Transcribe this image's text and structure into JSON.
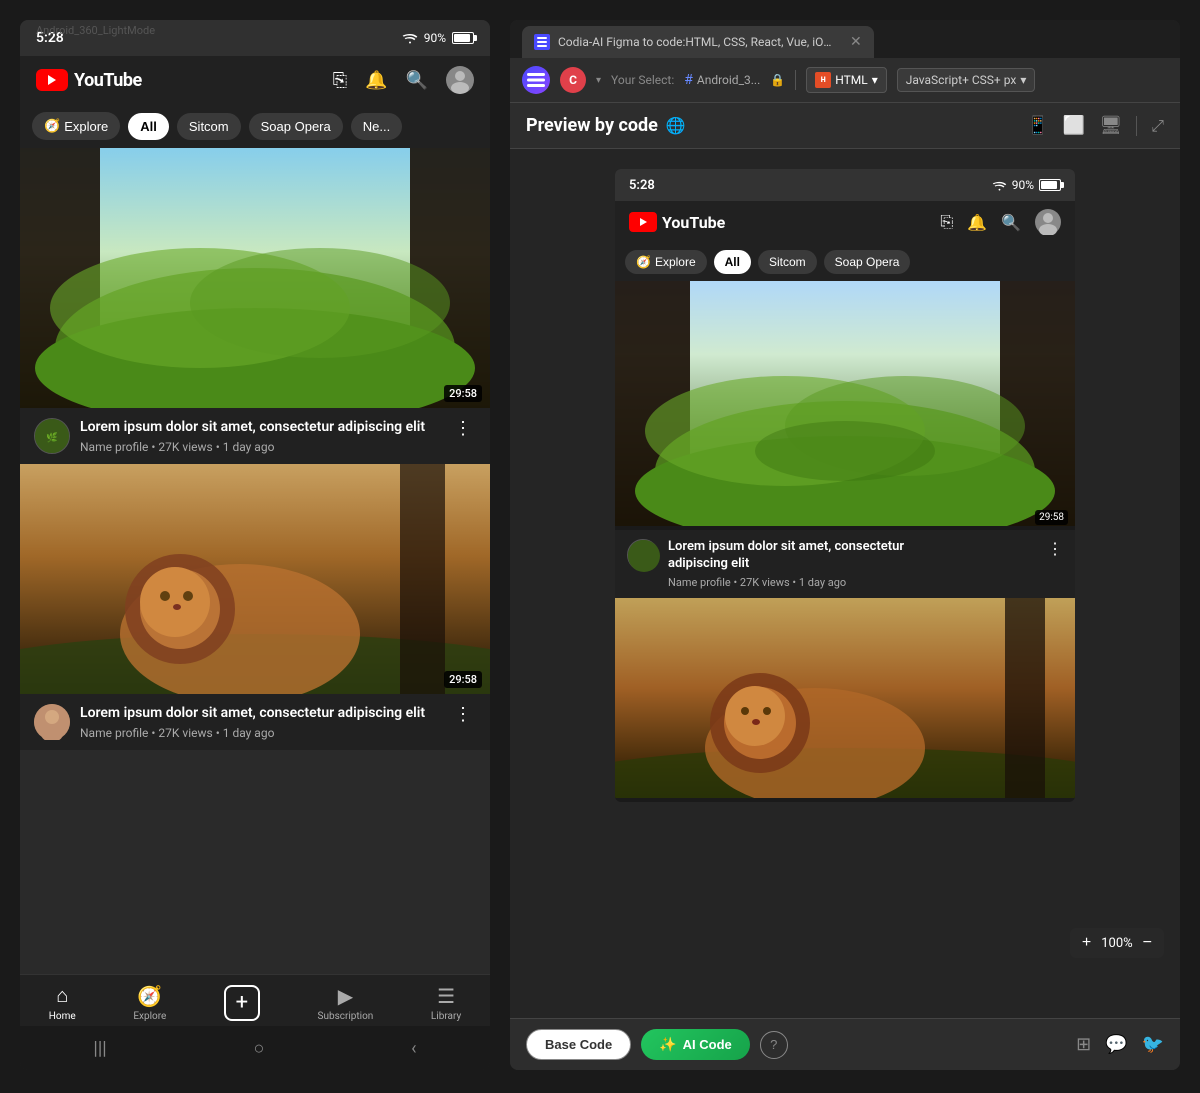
{
  "page": {
    "background": "#1a1a1a"
  },
  "header_label": "Android_360_LightMode",
  "left_panel": {
    "status_bar": {
      "time": "5:28",
      "battery_percent": "90%"
    },
    "yt_header": {
      "logo_text": "YouTube"
    },
    "filter_bar": {
      "items": [
        {
          "label": "Explore",
          "type": "explore"
        },
        {
          "label": "All",
          "type": "active"
        },
        {
          "label": "Sitcom",
          "type": "normal"
        },
        {
          "label": "Soap Opera",
          "type": "normal"
        },
        {
          "label": "Ne...",
          "type": "normal"
        }
      ]
    },
    "video1": {
      "duration": "29:58",
      "title": "Lorem ipsum dolor sit amet, consectetur adipiscing elit",
      "meta": "Name profile • 27K views • 1 day ago"
    },
    "video2": {
      "duration": "29:58",
      "title": "Lorem ipsum dolor sit amet, consectetur adipiscing elit",
      "meta": "Name profile • 27K views • 1 day ago"
    },
    "bottom_nav": {
      "items": [
        {
          "label": "Home",
          "icon": "home"
        },
        {
          "label": "Explore",
          "icon": "explore"
        },
        {
          "label": "",
          "icon": "add"
        },
        {
          "label": "Subscription",
          "icon": "subscription"
        },
        {
          "label": "Library",
          "icon": "library"
        }
      ]
    }
  },
  "right_panel": {
    "tab": {
      "title": "Codia-AI Figma to code:HTML, CSS, React, Vue, iOS, Android, Flutter, Tail..."
    },
    "toolbar": {
      "user_initial": "C",
      "your_select_label": "Your Select:",
      "component_id": "Android_3...",
      "html_label": "HTML",
      "js_css_label": "JavaScript+ CSS+ px"
    },
    "preview_header": {
      "title": "Preview by code",
      "icon": "🌐"
    },
    "preview": {
      "status_bar": {
        "time": "5:28",
        "battery_percent": "90%"
      },
      "yt_header": {
        "logo_text": "YouTube"
      },
      "filter_bar": {
        "items": [
          {
            "label": "Explore",
            "type": "explore"
          },
          {
            "label": "All",
            "type": "active"
          },
          {
            "label": "Sitcom",
            "type": "normal"
          },
          {
            "label": "Soap Opera",
            "type": "normal"
          }
        ]
      },
      "video1": {
        "duration": "29:58",
        "title": "Lorem ipsum dolor sit amet, consectetur",
        "title2": "adipiscing elit",
        "meta": "Name profile • 27K views • 1 day ago"
      }
    },
    "zoom": {
      "percent": "100%",
      "plus": "+",
      "minus": "−"
    },
    "bottom": {
      "base_code_label": "Base Code",
      "ai_code_label": "AI Code",
      "ai_code_icon": "✨"
    }
  }
}
